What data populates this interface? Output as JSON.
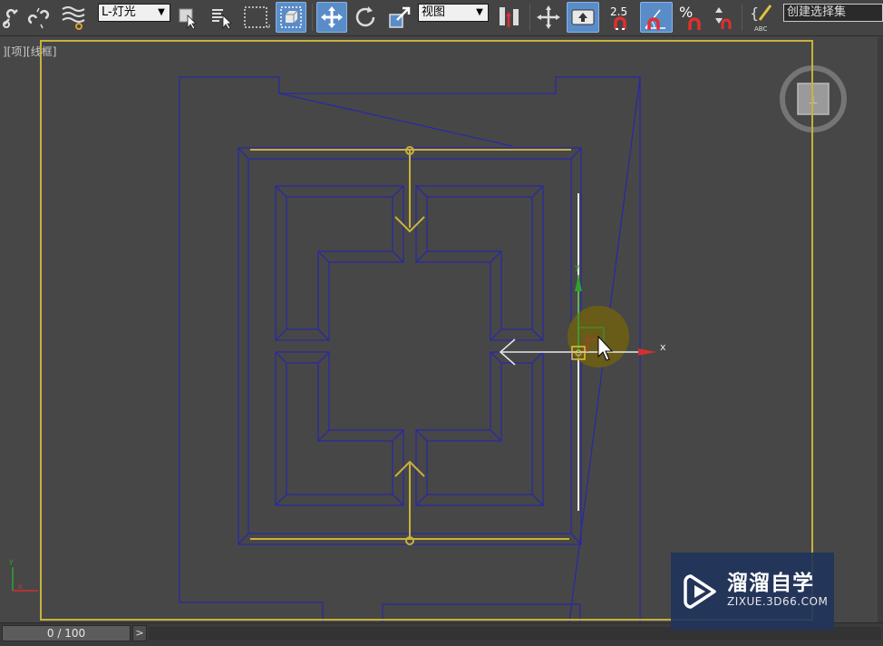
{
  "toolbar": {
    "layer_dropdown": "L-灯光",
    "coord_dropdown": "视图",
    "snap_angle_label": "2.5",
    "percent_label": "%",
    "abc_label": "ABC",
    "selection_set_field": "创建选择集"
  },
  "viewport": {
    "label": "][项][线框]",
    "gizmo_x_label": "x",
    "gizmo_y_label": "y"
  },
  "timeline": {
    "frame_display": "0 / 100",
    "next_label": ">"
  },
  "watermark": {
    "title": "溜溜自学",
    "url": "ZIXUE.3D66.COM"
  },
  "colors": {
    "background": "#474747",
    "wire": "#2a2aa0",
    "selected": "#c9b13d",
    "frame": "#c9b13d",
    "gizmo_x": "#d03030",
    "gizmo_y": "#30a030",
    "toolbar_active": "#5a8cc8"
  }
}
